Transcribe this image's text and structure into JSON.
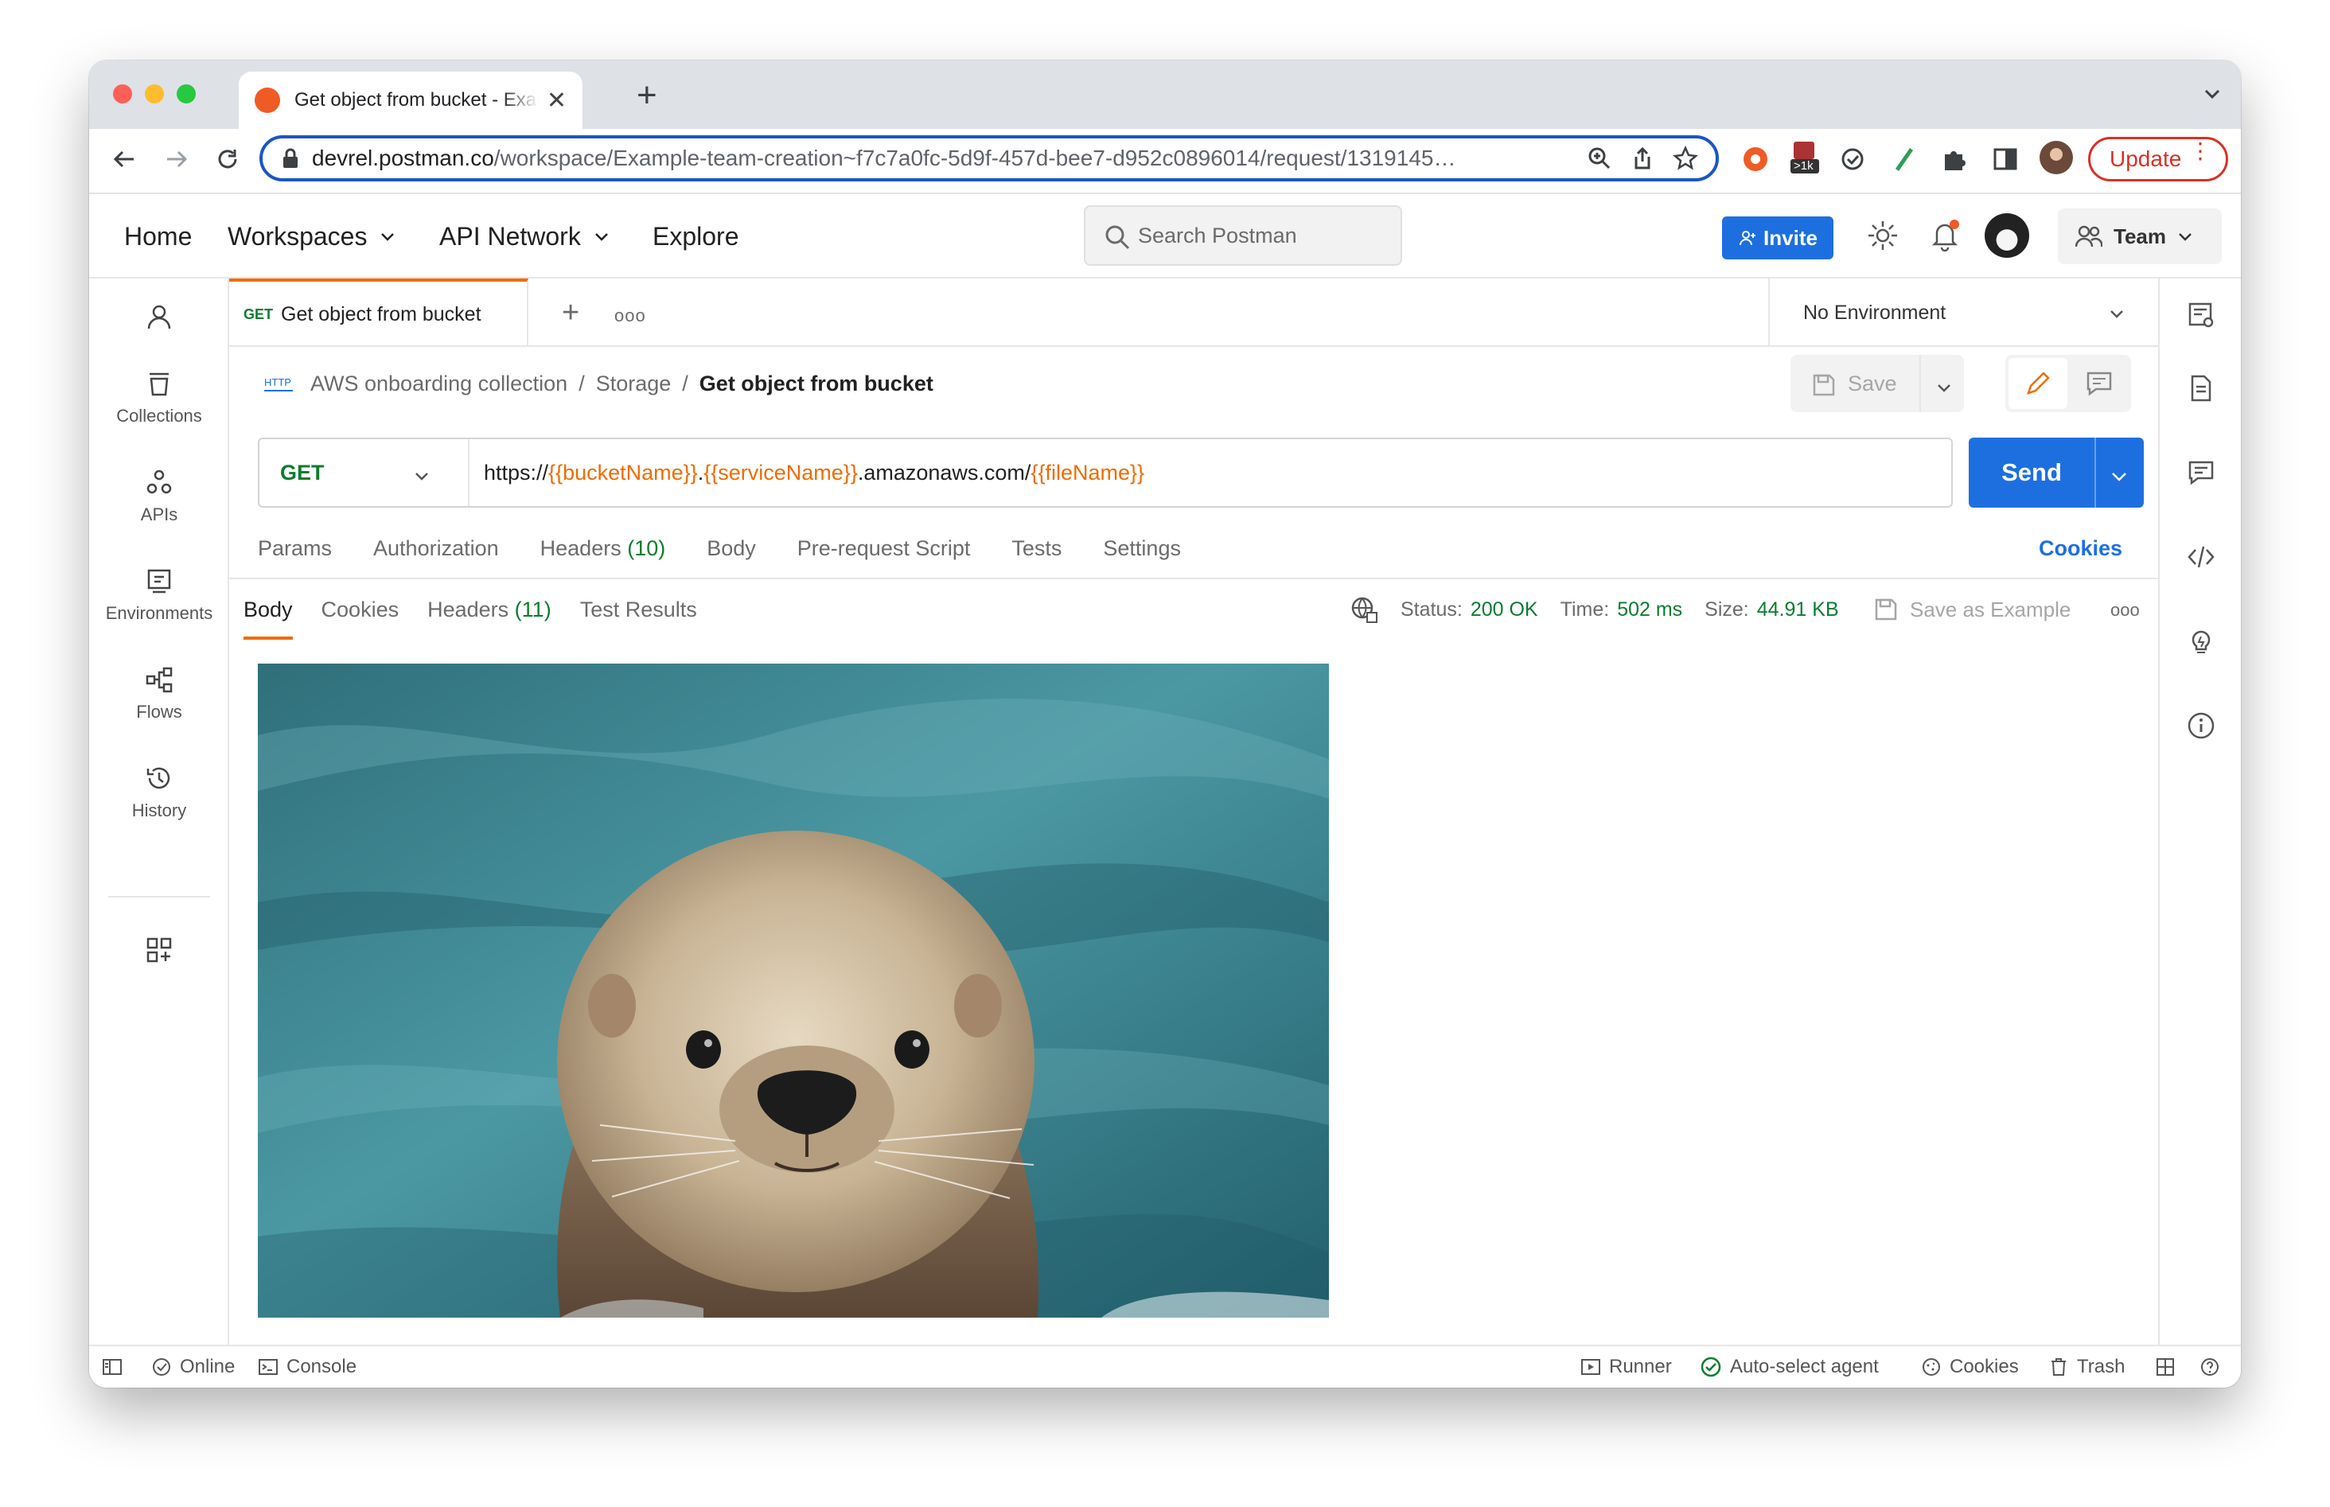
{
  "browser": {
    "tab_title": "Get object from bucket - Example team creation",
    "url_host": "devrel.postman.co",
    "url_path": "/workspace/Example-team-creation~f7c7a0fc-5d9f-457d-bee7-d952c0896014/request/1319145…",
    "ext_badge": ">1k",
    "update_label": "Update"
  },
  "nav": {
    "home": "Home",
    "workspaces": "Workspaces",
    "api_network": "API Network",
    "explore": "Explore",
    "search_placeholder": "Search Postman",
    "invite": "Invite",
    "team": "Team"
  },
  "sidebar": {
    "items": [
      {
        "label": "Collections"
      },
      {
        "label": "APIs"
      },
      {
        "label": "Environments"
      },
      {
        "label": "Flows"
      },
      {
        "label": "History"
      }
    ]
  },
  "request_tab": {
    "method": "GET",
    "title": "Get object from bucket"
  },
  "environment": "No Environment",
  "breadcrumb": {
    "collection": "AWS onboarding collection",
    "folder": "Storage",
    "request": "Get object from bucket",
    "sep": "/",
    "http_badge": "HTTP"
  },
  "actions": {
    "save": "Save",
    "send": "Send"
  },
  "request": {
    "method": "GET",
    "url_prefix": "https://",
    "var_bucket": "{{bucketName}}",
    "dot1": ".",
    "var_service": "{{serviceName}}",
    "url_mid": ".amazonaws.com/",
    "var_file": "{{fileName}}"
  },
  "request_tabs": {
    "params": "Params",
    "authorization": "Authorization",
    "headers": "Headers",
    "headers_count": "(10)",
    "body": "Body",
    "prerequest": "Pre-request Script",
    "tests": "Tests",
    "settings": "Settings",
    "cookies": "Cookies"
  },
  "response_tabs": {
    "body": "Body",
    "cookies": "Cookies",
    "headers": "Headers",
    "headers_count": "(11)",
    "test_results": "Test Results"
  },
  "response_meta": {
    "status_label": "Status:",
    "status": "200 OK",
    "time_label": "Time:",
    "time": "502 ms",
    "size_label": "Size:",
    "size": "44.91 KB",
    "save_example": "Save as Example"
  },
  "statusbar": {
    "online": "Online",
    "console": "Console",
    "runner": "Runner",
    "agent": "Auto-select agent",
    "cookies": "Cookies",
    "trash": "Trash"
  },
  "colors": {
    "accent": "#ef6c00",
    "primary": "#1d6fe0",
    "success": "#0a7c2f",
    "update": "#d93025"
  }
}
